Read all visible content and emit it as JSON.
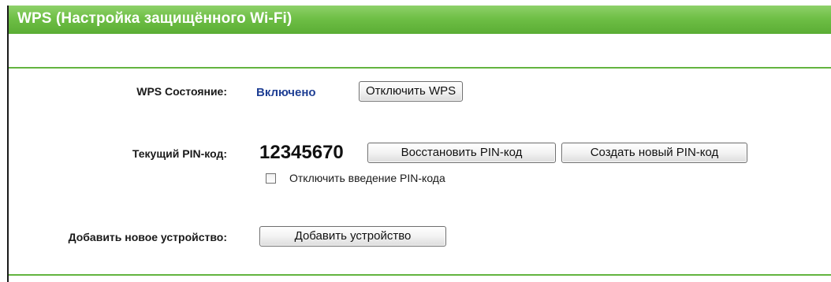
{
  "header": {
    "title": "WPS (Настройка защищённого Wi-Fi)"
  },
  "wps_status": {
    "label": "WPS Состояние:",
    "value": "Включено",
    "disable_button": "Отключить WPS"
  },
  "pin": {
    "label": "Текущий PIN-код:",
    "value": "12345670",
    "restore_button": "Восстановить PIN-код",
    "generate_button": "Создать новый PIN-код",
    "disable_pin_checkbox_label": "Отключить введение PIN-кода",
    "disable_pin_checked": false
  },
  "add_device": {
    "label": "Добавить новое устройство:",
    "button": "Добавить устройство"
  },
  "colors": {
    "header_green": "#6fbf46",
    "status_blue": "#1f3f94"
  }
}
